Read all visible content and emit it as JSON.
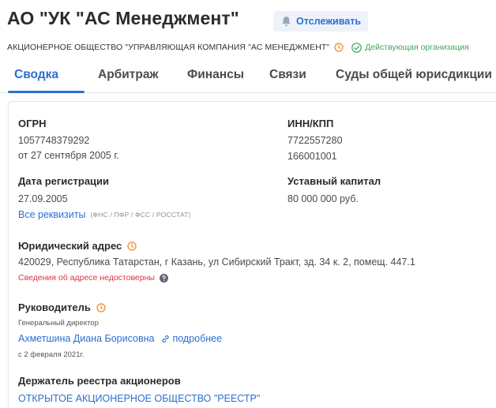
{
  "header": {
    "title": "АО \"УК \"АС Менеджмент\"",
    "track_label": "Отслеживать",
    "full_name": "АКЦИОНЕРНОЕ ОБЩЕСТВО \"УПРАВЛЯЮЩАЯ КОМПАНИЯ \"АС МЕНЕДЖМЕНТ\"",
    "status": "Действующая организация"
  },
  "tabs": [
    {
      "label": "Сводка"
    },
    {
      "label": "Арбитраж"
    },
    {
      "label": "Финансы"
    },
    {
      "label": "Связи"
    },
    {
      "label": "Суды общей юрисдикции"
    }
  ],
  "summary": {
    "ogrn": {
      "title": "ОГРН",
      "value": "1057748379292",
      "date": "от 27 сентября 2005 г."
    },
    "inn_kpp": {
      "title": "ИНН/КПП",
      "inn": "7722557280",
      "kpp": "166001001"
    },
    "reg_date": {
      "title": "Дата регистрации",
      "value": "27.09.2005"
    },
    "capital": {
      "title": "Уставный капитал",
      "value": "80 000 000 руб."
    },
    "requisites": {
      "link": "Все реквизиты",
      "hint": "(ФНС / ПФР / ФСС / РОССТАТ)"
    },
    "address": {
      "title": "Юридический адрес",
      "value": "420029, Республика Татарстан, г Казань, ул Сибирский Тракт, зд. 34 к. 2, помещ. 447.1",
      "warning": "Сведения об адресе недостоверны"
    },
    "head": {
      "title": "Руководитель",
      "role": "Генеральный директор",
      "name": "Ахметшина Диана Борисовна",
      "more": "подробнее",
      "since": "с 2 февраля 2021г."
    },
    "registrar": {
      "title": "Держатель реестра акционеров",
      "value": "ОТКРЫТОЕ АКЦИОНЕРНОЕ ОБЩЕСТВО \"РЕЕСТР\""
    }
  },
  "colors": {
    "accent": "#2c6fd1",
    "success": "#3aa85a",
    "danger": "#e0323c",
    "clock": "#f28c28"
  }
}
